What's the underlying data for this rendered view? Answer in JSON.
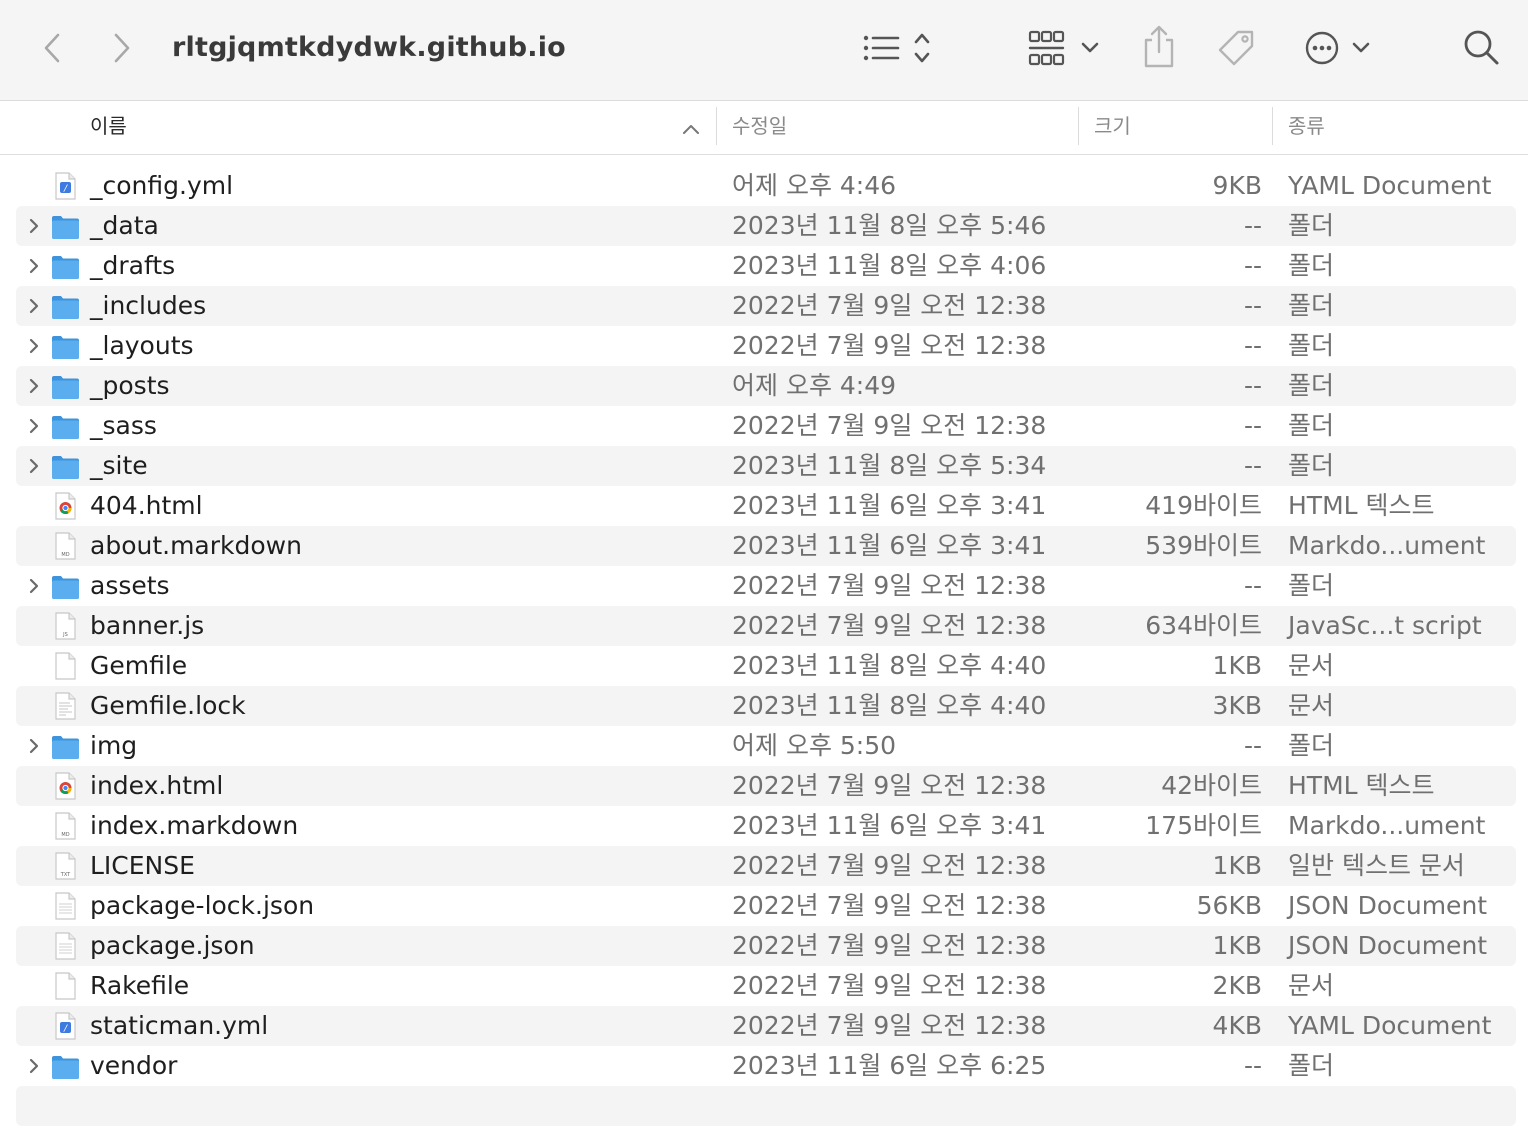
{
  "window": {
    "title": "rltgjqmtkdydwk.github.io"
  },
  "toolbar": {
    "icons": [
      "back-icon",
      "forward-icon",
      "list-view-icon",
      "group-icon",
      "share-icon",
      "tag-icon",
      "more-icon",
      "search-icon"
    ]
  },
  "columns": {
    "name": "이름",
    "modified": "수정일",
    "size": "크기",
    "kind": "종류"
  },
  "colors": {
    "folder": "#5aaef0",
    "folder_dark": "#3e94dc",
    "row_alt": "#f4f4f4"
  },
  "files": [
    {
      "name": "_config.yml",
      "date": "어제 오후 4:46",
      "size": "9KB",
      "kind": "YAML Document",
      "icon": "yaml-file-icon",
      "folder": false
    },
    {
      "name": "_data",
      "date": "2023년 11월 8일 오후 5:46",
      "size": "--",
      "kind": "폴더",
      "icon": "folder-icon",
      "folder": true
    },
    {
      "name": "_drafts",
      "date": "2023년 11월 8일 오후 4:06",
      "size": "--",
      "kind": "폴더",
      "icon": "folder-icon",
      "folder": true
    },
    {
      "name": "_includes",
      "date": "2022년 7월 9일 오전 12:38",
      "size": "--",
      "kind": "폴더",
      "icon": "folder-icon",
      "folder": true
    },
    {
      "name": "_layouts",
      "date": "2022년 7월 9일 오전 12:38",
      "size": "--",
      "kind": "폴더",
      "icon": "folder-icon",
      "folder": true
    },
    {
      "name": "_posts",
      "date": "어제 오후 4:49",
      "size": "--",
      "kind": "폴더",
      "icon": "folder-icon",
      "folder": true
    },
    {
      "name": "_sass",
      "date": "2022년 7월 9일 오전 12:38",
      "size": "--",
      "kind": "폴더",
      "icon": "folder-icon",
      "folder": true
    },
    {
      "name": "_site",
      "date": "2023년 11월 8일 오후 5:34",
      "size": "--",
      "kind": "폴더",
      "icon": "folder-icon",
      "folder": true
    },
    {
      "name": "404.html",
      "date": "2023년 11월 6일 오후 3:41",
      "size": "419바이트",
      "kind": "HTML 텍스트",
      "icon": "chrome-html-icon",
      "folder": false
    },
    {
      "name": "about.markdown",
      "date": "2023년 11월 6일 오후 3:41",
      "size": "539바이트",
      "kind": "Markdo...ument",
      "icon": "markdown-file-icon",
      "folder": false
    },
    {
      "name": "assets",
      "date": "2022년 7월 9일 오전 12:38",
      "size": "--",
      "kind": "폴더",
      "icon": "folder-icon",
      "folder": true
    },
    {
      "name": "banner.js",
      "date": "2022년 7월 9일 오전 12:38",
      "size": "634바이트",
      "kind": "JavaSc...t script",
      "icon": "js-file-icon",
      "folder": false
    },
    {
      "name": "Gemfile",
      "date": "2023년 11월 8일 오후 4:40",
      "size": "1KB",
      "kind": "문서",
      "icon": "blank-file-icon",
      "folder": false
    },
    {
      "name": "Gemfile.lock",
      "date": "2023년 11월 8일 오후 4:40",
      "size": "3KB",
      "kind": "문서",
      "icon": "text-file-icon",
      "folder": false
    },
    {
      "name": "img",
      "date": "어제 오후 5:50",
      "size": "--",
      "kind": "폴더",
      "icon": "folder-icon",
      "folder": true
    },
    {
      "name": "index.html",
      "date": "2022년 7월 9일 오전 12:38",
      "size": "42바이트",
      "kind": "HTML 텍스트",
      "icon": "chrome-html-icon",
      "folder": false
    },
    {
      "name": "index.markdown",
      "date": "2023년 11월 6일 오후 3:41",
      "size": "175바이트",
      "kind": "Markdo...ument",
      "icon": "markdown-file-icon",
      "folder": false
    },
    {
      "name": "LICENSE",
      "date": "2022년 7월 9일 오전 12:38",
      "size": "1KB",
      "kind": "일반 텍스트 문서",
      "icon": "txt-file-icon",
      "folder": false
    },
    {
      "name": "package-lock.json",
      "date": "2022년 7월 9일 오전 12:38",
      "size": "56KB",
      "kind": "JSON Document",
      "icon": "json-file-icon",
      "folder": false
    },
    {
      "name": "package.json",
      "date": "2022년 7월 9일 오전 12:38",
      "size": "1KB",
      "kind": "JSON Document",
      "icon": "json-file-icon",
      "folder": false
    },
    {
      "name": "Rakefile",
      "date": "2022년 7월 9일 오전 12:38",
      "size": "2KB",
      "kind": "문서",
      "icon": "blank-file-icon",
      "folder": false
    },
    {
      "name": "staticman.yml",
      "date": "2022년 7월 9일 오전 12:38",
      "size": "4KB",
      "kind": "YAML Document",
      "icon": "yaml-file-icon",
      "folder": false
    },
    {
      "name": "vendor",
      "date": "2023년 11월 6일 오후 6:25",
      "size": "--",
      "kind": "폴더",
      "icon": "folder-icon",
      "folder": true
    }
  ]
}
